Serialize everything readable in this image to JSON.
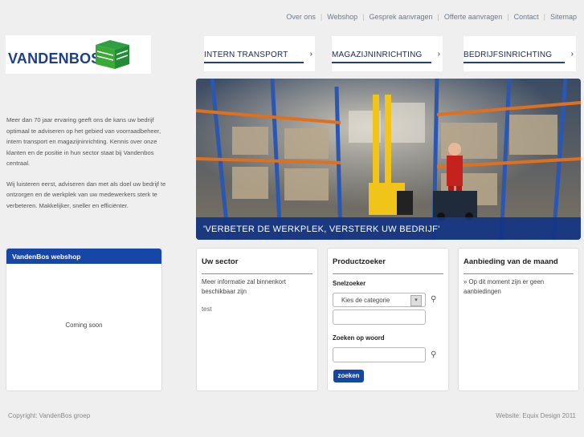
{
  "topnav": {
    "items": [
      "Over ons",
      "Webshop",
      "Gesprek aanvragen",
      "Offerte aanvragen",
      "Contact",
      "Sitemap"
    ]
  },
  "logo": {
    "text": "VANDENBOS"
  },
  "mainnav": {
    "items": [
      {
        "label": "INTERN TRANSPORT",
        "chevron": "›"
      },
      {
        "label": "MAGAZIJNINRICHTING",
        "chevron": "›"
      },
      {
        "label": "BEDRIJFSINRICHTING",
        "chevron": "›"
      }
    ]
  },
  "intro": {
    "p1": "Meer dan 70 jaar ervaring geeft ons de kans uw bedrijf optimaal te adviseren op het gebied van voorraadbeheer, intern transport en magazijninrichting. Kennis over onze klanten en de positie in hun sector staat bij Vandenbos centraal.",
    "p2": "Wij luisteren eerst, adviseren dan met als doel uw bedrijf te ontzorgen en de werkplek van uw medewerkers sterk te verbeteren. Makkelijker, sneller en efficiënter."
  },
  "hero": {
    "caption": "'VERBETER DE WERKPLEK, VERSTERK UW BEDRIJF'"
  },
  "webshop": {
    "title": "VandenBos webshop",
    "body": "Coming soon"
  },
  "sector": {
    "title": "Uw sector",
    "body": "Meer informatie zal binnenkort beschikbaar zijn",
    "extra": "test"
  },
  "productzoeker": {
    "title": "Productzoeker",
    "quick_label": "Snelzoeker",
    "category_value": "Kies de categorie",
    "word_label": "Zoeken op woord",
    "button": "zoeken"
  },
  "aanbieding": {
    "title": "Aanbieding van de maand",
    "body": "» Op dit moment zijn er geen aanbiedingen"
  },
  "footer": {
    "left": "Copyright: VandenBos groep",
    "right": "Website: Equix Design 2011"
  },
  "colors": {
    "brand": "#1d3f8a",
    "accent": "#1747a6",
    "logo_green": "#3aa935"
  }
}
